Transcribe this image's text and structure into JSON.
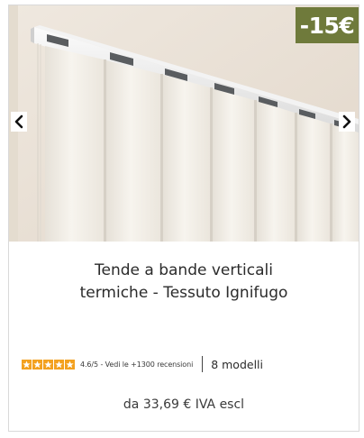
{
  "product": {
    "title": "Tende a bande verticali\ntermiche - Tessuto Ignifugo",
    "discount_badge": "-15€",
    "rating_text": "4.6/5 - Vedi le +1300 recensioni",
    "rating_value": 4.6,
    "rating_max": 5,
    "models_text": "8 modelli",
    "price_text": "da 33,69 € IVA escl"
  },
  "icons": {
    "prev": "chevron-left-icon",
    "next": "chevron-right-icon",
    "star": "star-icon"
  },
  "colors": {
    "badge_bg": "#6f7a3b",
    "star": "#f3a11f",
    "wall": "#e9e0d5",
    "blind": "#f4f0e8"
  }
}
